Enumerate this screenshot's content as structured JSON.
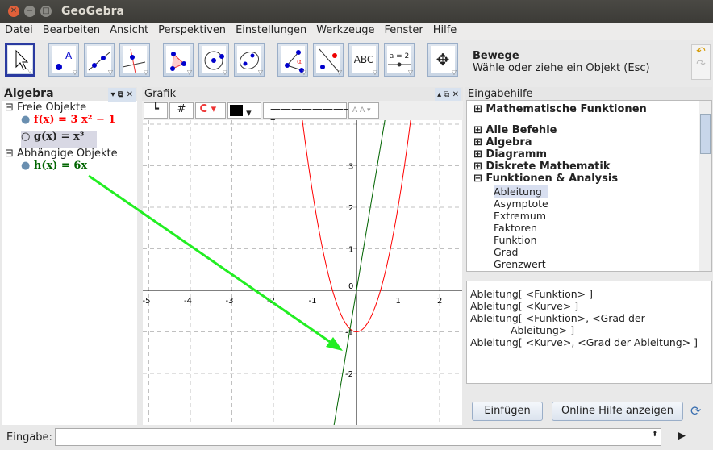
{
  "window": {
    "title": "GeoGebra"
  },
  "menu": [
    "Datei",
    "Bearbeiten",
    "Ansicht",
    "Perspektiven",
    "Einstellungen",
    "Werkzeuge",
    "Fenster",
    "Hilfe"
  ],
  "toolbar": {
    "tools": [
      "move-tool",
      "point-tool",
      "line-tool",
      "perpendicular-tool",
      "polygon-tool",
      "circle-tool",
      "conic-tool",
      "angle-tool",
      "reflect-tool",
      "text-tool",
      "slider-tool",
      "move-graphics-tool"
    ],
    "text_tool_label": "ABC",
    "slider_label": "a = 2",
    "help_title": "Bewege",
    "help_text": "Wähle oder ziehe ein Objekt (Esc)"
  },
  "algebra": {
    "title": "Algebra",
    "free_header": "Freie Objekte",
    "dependent_header": "Abhängige Objekte",
    "objects": [
      {
        "text": "f(x) = 3 x² − 1",
        "color": "#ff0000"
      },
      {
        "text": "g(x) = x³",
        "color": "#000000"
      },
      {
        "text": "h(x) = 6x",
        "color": "#006400"
      }
    ]
  },
  "graphics": {
    "title": "Grafik",
    "xticks": [
      "-5",
      "-4",
      "-3",
      "-2",
      "-1",
      "0",
      "1",
      "2"
    ],
    "yticks": [
      "3",
      "2",
      "1",
      "-1",
      "-2"
    ],
    "style_aa": "A A"
  },
  "inputhelp": {
    "title": "Eingabehilfe",
    "math_functions": "Mathematische Funktionen",
    "categories": [
      "Alle Befehle",
      "Algebra",
      "Diagramm",
      "Diskrete Mathematik",
      "Funktionen & Analysis"
    ],
    "commands": [
      "Ableitung",
      "Asymptote",
      "Extremum",
      "Faktoren",
      "Funktion",
      "Grad",
      "Grenzwert"
    ],
    "syntax": [
      "Ableitung[ <Funktion> ]",
      "Ableitung[ <Kurve> ]",
      "Ableitung[ <Funktion>, <Grad der",
      "Ableitung> ]",
      "Ableitung[ <Kurve>, <Grad der Ableitung> ]"
    ],
    "insert_button": "Einfügen",
    "online_help_button": "Online Hilfe anzeigen"
  },
  "input": {
    "label": "Eingabe:",
    "value": ""
  }
}
